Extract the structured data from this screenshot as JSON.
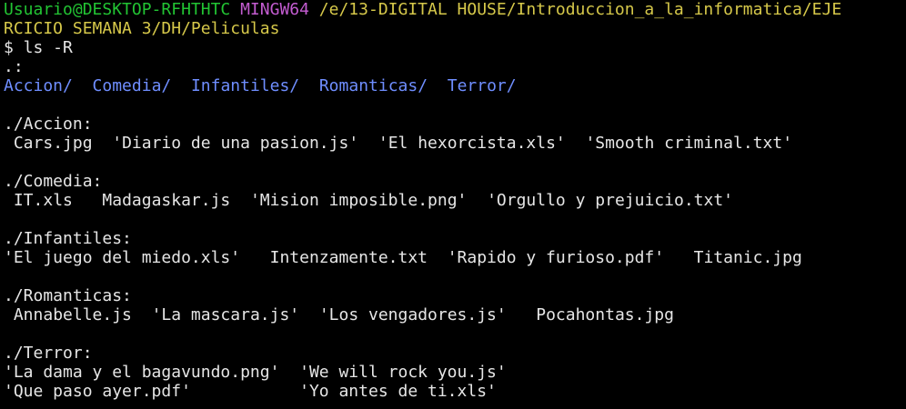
{
  "prompt": {
    "user_host": "Usuario@DESKTOP-RFHTHTC",
    "env": "MINGW64",
    "path_line1": "/e/13-DIGITAL HOUSE/Introduccion_a_la_informatica/EJE",
    "path_line2": "RCICIO SEMANA 3/DH/Peliculas",
    "command": "$ ls -R"
  },
  "root": {
    "header": ".:",
    "dirs": [
      "Accion/",
      "Comedia/",
      "Infantiles/",
      "Romanticas/",
      "Terror/"
    ]
  },
  "sections": [
    {
      "header": "./Accion:",
      "rows": [
        [
          "Cars.jpg",
          "'Diario de una pasion.js'",
          "'El hexorcista.xls'",
          "'Smooth criminal.txt'"
        ]
      ]
    },
    {
      "header": "./Comedia:",
      "rows": [
        [
          "IT.xls",
          "Madagaskar.js",
          "'Mision imposible.png'",
          "'Orgullo y prejuicio.txt'"
        ]
      ]
    },
    {
      "header": "./Infantiles:",
      "rows": [
        [
          "'El juego del miedo.xls'",
          "Intenzamente.txt",
          "'Rapido y furioso.pdf'",
          "Titanic.jpg"
        ]
      ]
    },
    {
      "header": "./Romanticas:",
      "rows": [
        [
          "Annabelle.js",
          "'La mascara.js'",
          "'Los vengadores.js'",
          "Pocahontas.jpg"
        ]
      ]
    },
    {
      "header": "./Terror:",
      "rows": [
        [
          "'La dama y el bagavundo.png'",
          "'We will rock you.js'"
        ],
        [
          "'Que paso ayer.pdf'",
          "'Yo antes de ti.xls'"
        ]
      ]
    }
  ],
  "colors": {
    "background": "#000000",
    "text": "#e6e6e6",
    "user": "#22c433",
    "env": "#c35cd0",
    "path": "#d6c84a",
    "directory": "#6f8eff"
  }
}
